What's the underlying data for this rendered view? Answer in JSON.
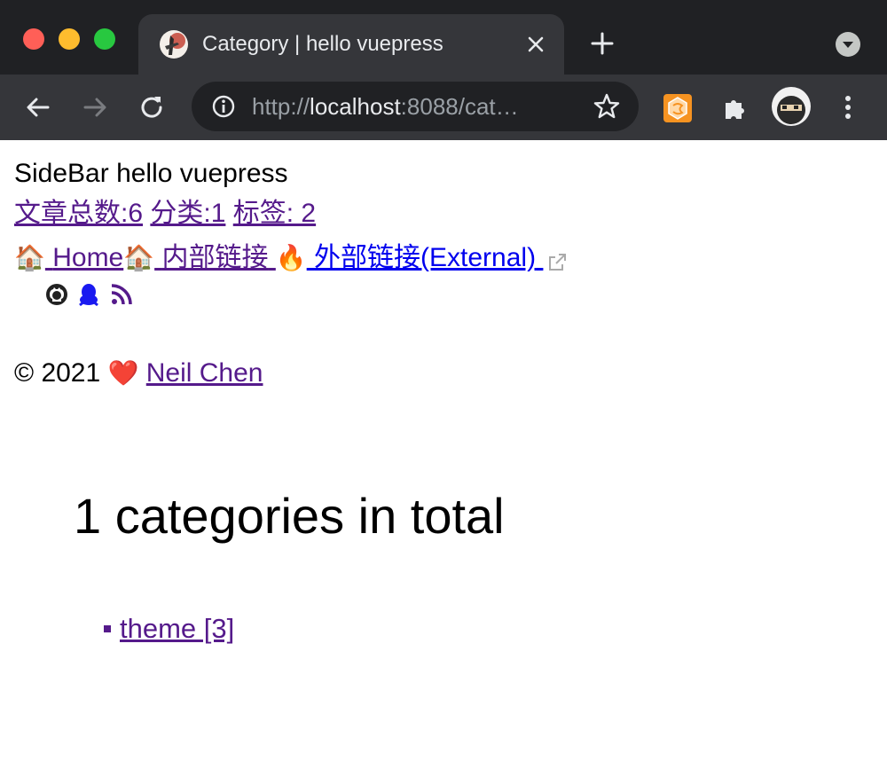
{
  "browser": {
    "tab": {
      "title": "Category | hello vuepress"
    },
    "address_bar": {
      "scheme": "http://",
      "host": "localhost",
      "rest": ":8088/cat…"
    }
  },
  "sidebar": {
    "title": "SideBar hello vuepress",
    "stats": {
      "articles": "文章总数:6",
      "categories": "分类:1",
      "tags": "标签: 2"
    }
  },
  "nav": {
    "home_emoji": "🏠",
    "home_label": "Home",
    "internal_emoji": "🏠",
    "internal_label": "内部链接",
    "external_emoji": "🔥",
    "external_label": "外部链接(External)"
  },
  "social_icons": [
    "github-icon",
    "qq-icon",
    "rss-icon"
  ],
  "footer": {
    "copyright": "© 2021",
    "heart": "❤️",
    "author": "Neil Chen"
  },
  "category_page": {
    "heading": "1 categories in total",
    "categories": [
      {
        "label": "theme [3]"
      }
    ]
  },
  "colors": {
    "chrome_dark": "#202124",
    "chrome_tab": "#35363a",
    "visited_link": "#551a8b",
    "link": "#0000ee"
  }
}
